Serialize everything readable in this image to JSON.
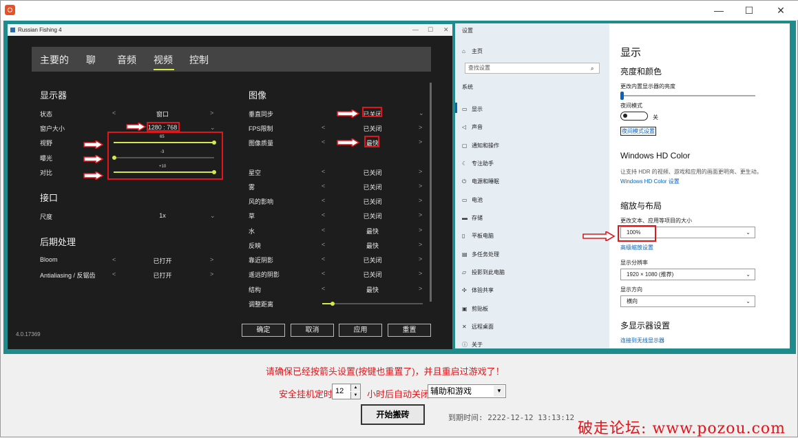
{
  "window": {
    "min": "—",
    "max": "☐",
    "close": "✕"
  },
  "game": {
    "title": "Russian Fishing 4",
    "tb": {
      "min": "—",
      "max": "☐",
      "close": "✕"
    },
    "tabs": [
      "主要的",
      "聊",
      "音频",
      "视频",
      "控制"
    ],
    "left": {
      "display_h": "显示器",
      "rows": [
        {
          "label": "状态",
          "value": "窗口"
        },
        {
          "label": "窗户大小",
          "value": "1280 : 768"
        },
        {
          "label": "视野",
          "value": "65"
        },
        {
          "label": "曝光",
          "value": "-3"
        },
        {
          "label": "对比",
          "value": "+10"
        }
      ],
      "iface_h": "接口",
      "iface_rows": [
        {
          "label": "尺度",
          "value": "1x"
        }
      ],
      "post_h": "后期处理",
      "post_rows": [
        {
          "label": "Bloom",
          "value": "已打开"
        },
        {
          "label": "Antialiasing / 反锯齿",
          "value": "已打开"
        }
      ]
    },
    "right": {
      "h": "图像",
      "rows": [
        {
          "label": "垂直同步",
          "value": "已关闭"
        },
        {
          "label": "FPS限制",
          "value": "已关闭"
        },
        {
          "label": "图像质量",
          "value": "最快"
        },
        {
          "label": "星空",
          "value": "已关闭"
        },
        {
          "label": "雾",
          "value": "已关闭"
        },
        {
          "label": "风的影响",
          "value": "已关闭"
        },
        {
          "label": "草",
          "value": "已关闭"
        },
        {
          "label": "水",
          "value": "最快"
        },
        {
          "label": "反映",
          "value": "最快"
        },
        {
          "label": "靠近阴影",
          "value": "已关闭"
        },
        {
          "label": "遥远的阴影",
          "value": "已关闭"
        },
        {
          "label": "结构",
          "value": "最快"
        },
        {
          "label": "调整距离",
          "value": ""
        }
      ]
    },
    "buttons": {
      "ok": "确定",
      "cancel": "取消",
      "apply": "应用",
      "reset": "重置"
    },
    "version": "4.0.17369"
  },
  "settings": {
    "title": "设置",
    "home": "主页",
    "search": "查找设置",
    "system": "系统",
    "nav": [
      "显示",
      "声音",
      "通知和操作",
      "专注助手",
      "电源和睡眠",
      "电池",
      "存储",
      "平板电脑",
      "多任务处理",
      "投影到此电脑",
      "体验共享",
      "剪贴板",
      "远程桌面",
      "关于"
    ],
    "main": {
      "title": "显示",
      "brightness_h": "亮度和颜色",
      "brightness_label": "更改内置显示器的亮度",
      "night_label": "夜间模式",
      "night_state": "关",
      "night_link": "夜间模式设置",
      "hd_h": "Windows HD Color",
      "hd_desc": "让支持 HDR 的视频、游戏和应用的画面更明亮、更生动。",
      "hd_link": "Windows HD Color 设置",
      "scale_h": "缩放与布局",
      "scale_label": "更改文本、应用等项目的大小",
      "scale_val": "100%",
      "scale_link": "高级缩放设置",
      "res_label": "显示分辨率",
      "res_val": "1920 × 1080 (推荐)",
      "orient_label": "显示方向",
      "orient_val": "横向",
      "multi_h": "多显示器设置",
      "multi_link": "连接到无线显示器"
    }
  },
  "bottom": {
    "warning": "请确保已经按箭头设置(按键也重置了)，并且重启过游戏了！",
    "timer_label": "安全挂机定时",
    "hours": "12",
    "after": "小时后自动关闭",
    "combo": "辅助和游戏",
    "start": "开始搬砖",
    "expiry": "到期时间: 2222-12-12 13:13:12",
    "forum": "破走论坛: www.pozou.com"
  },
  "colors": {
    "accent": "#d7e94a",
    "red": "#e2151b",
    "teal": "#1f8b8d",
    "link": "#0a62b8"
  }
}
